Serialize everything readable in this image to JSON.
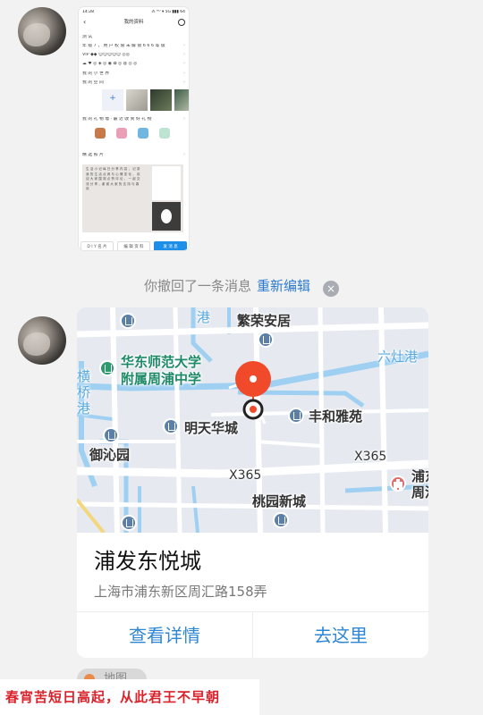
{
  "screenshot_thumb": {
    "status_time": "14:28",
    "status_right": "⁂ ᴴᴰ ▾ 5G ▮▮▮ 64",
    "title": "我的资料",
    "name": "测 试",
    "line1": "年 级 7 ，  用 户 权 限 未 解 锁 6 6 6 等 级",
    "line2": "VIP ◆◆ 😊😊😊😊😊 ◎◎",
    "line3": "☁ ♥ ◎ ◈ ◎ ◉ ✿ ◎ ◍ ◎ ◎",
    "line4": "我 的 小 世 界",
    "line5": "我 的 空 间",
    "add_label": "+",
    "line6": "我 的 礼 物 墙 · 最 近 收 到 好 礼 物",
    "line7": "精 选 照 片",
    "post_text": "生 活 小 记 每 日 分 享 内 容 ， 记 录 我 的 生 活 点 滴 与 心 情 变 化 ， 欢 迎 大 家 围 观 点 赞 评 论 ， 一 起 交 流 分 享 ，谢 谢 大 家 的 支 持 与 喜 欢",
    "btn1": "D I Y 名 片",
    "btn2": "编 辑 资 料",
    "btn3": "发 消 息"
  },
  "recall_notice": {
    "text": "你撤回了一条消息",
    "action": "重新编辑",
    "close_icon": "×"
  },
  "location": {
    "map_labels": {
      "l1": "繁荣安居",
      "l2": "华东师范大学",
      "l3": "附属周浦中学",
      "l4": "六灶港",
      "l5": "丰和雅苑",
      "l6": "明天华城",
      "l7": "御沁园",
      "l8": "X365",
      "l9": "X365",
      "l10": "桃园新城",
      "l11": "浦东",
      "l12": "周浦",
      "l13": "横",
      "l14": "桥",
      "l15": "港",
      "l16": "港"
    },
    "name": "浦发东悦城",
    "address": "上海市浦东新区周汇路158弄",
    "detail_button": "查看详情",
    "go_button": "去这里"
  },
  "bottom_tag": "地图",
  "watermark_text": "春宵苦短日高起，从此君王不早朝",
  "colors": {
    "accent": "#2f86d3",
    "marker": "#f04a2a",
    "water": "#9fd0f2",
    "watermark": "#d9232d"
  }
}
